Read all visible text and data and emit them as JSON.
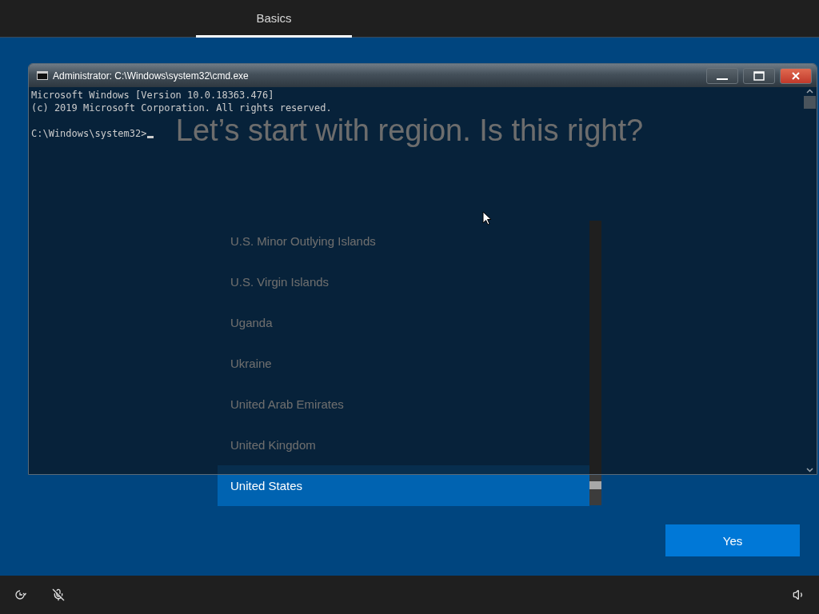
{
  "top_bar": {
    "tabs": [
      {
        "label": "Basics",
        "selected": true
      }
    ]
  },
  "page": {
    "heading": "Let’s start with region. Is this right?",
    "regions": [
      {
        "name": "U.S. Minor Outlying Islands",
        "selected": false
      },
      {
        "name": "U.S. Virgin Islands",
        "selected": false
      },
      {
        "name": "Uganda",
        "selected": false
      },
      {
        "name": "Ukraine",
        "selected": false
      },
      {
        "name": "United Arab Emirates",
        "selected": false
      },
      {
        "name": "United Kingdom",
        "selected": false
      },
      {
        "name": "United States",
        "selected": true
      }
    ],
    "yes_button": "Yes"
  },
  "console_window": {
    "title": "Administrator: C:\\Windows\\system32\\cmd.exe",
    "output": [
      "Microsoft Windows [Version 10.0.18363.476]",
      "(c) 2019 Microsoft Corporation. All rights reserved."
    ],
    "prompt": "C:\\Windows\\system32>"
  }
}
